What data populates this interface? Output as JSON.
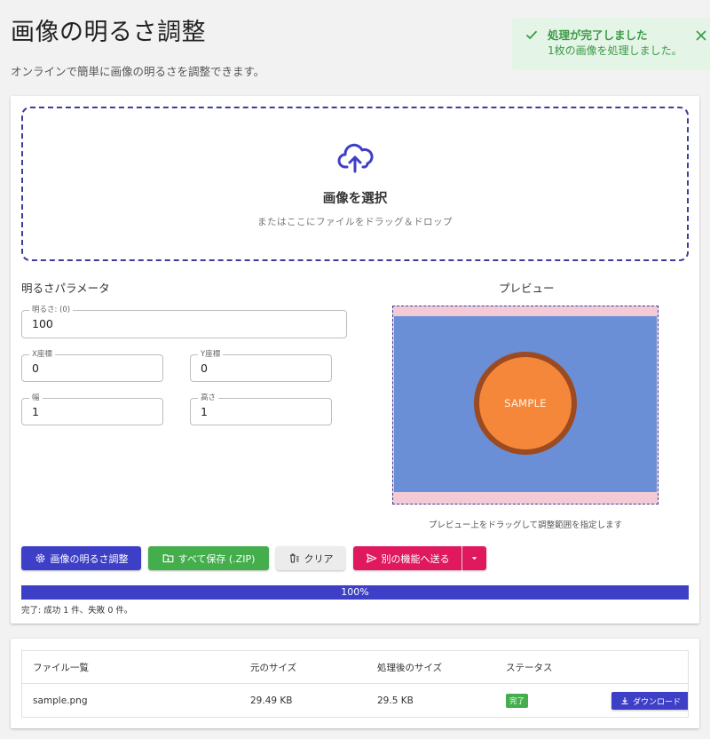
{
  "page": {
    "title": "画像の明るさ調整",
    "subtitle": "オンラインで簡単に画像の明るさを調整できます。"
  },
  "toast": {
    "title": "処理が完了しました",
    "message": "1枚の画像を処理しました。",
    "color": "#3a9a45",
    "icons": {
      "status": "check-icon",
      "close": "close-icon"
    }
  },
  "dropzone": {
    "title": "画像を選択",
    "subtitle": "またはここにファイルをドラッグ＆ドロップ",
    "icon": "cloud-upload-icon"
  },
  "params": {
    "title": "明るさパラメータ",
    "brightness": {
      "label": "明るさ: (0)",
      "value": "100"
    },
    "x": {
      "label": "X座標",
      "value": "0"
    },
    "y": {
      "label": "Y座標",
      "value": "0"
    },
    "width": {
      "label": "幅",
      "value": "1"
    },
    "height": {
      "label": "高さ",
      "value": "1"
    }
  },
  "preview": {
    "title": "プレビュー",
    "image_text": "SAMPLE",
    "hint": "プレビュー上をドラッグして調整範囲を指定します"
  },
  "actions": {
    "adjust": "画像の明るさ調整",
    "save_zip": "すべて保存 (.ZIP)",
    "clear": "クリア",
    "send": "別の機能へ送る"
  },
  "progress": {
    "percent": 100,
    "label": "100%",
    "status": "完了: 成功 1 件、失敗 0 件。"
  },
  "files": {
    "headers": [
      "ファイル一覧",
      "元のサイズ",
      "処理後のサイズ",
      "ステータス"
    ],
    "rows": [
      {
        "name": "sample.png",
        "original_size": "29.49 KB",
        "processed_size": "29.5 KB",
        "status": "完了",
        "download": "ダウンロード"
      }
    ]
  },
  "colors": {
    "primary": "#3d3fc6",
    "success": "#44ad4c",
    "accent": "#e0195f"
  }
}
